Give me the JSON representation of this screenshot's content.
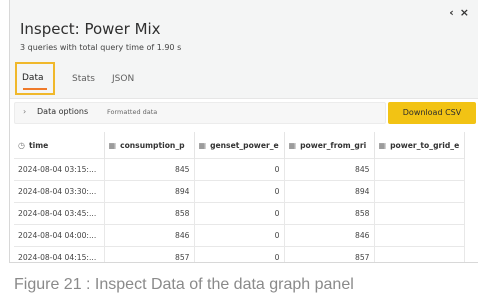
{
  "window": {
    "collapse_icon": "‹",
    "close_icon": "×"
  },
  "header": {
    "title": "Inspect: Power Mix",
    "subtitle": "3 queries with total query time of 1.90 s"
  },
  "tabs": [
    {
      "label": "Data",
      "active": true
    },
    {
      "label": "Stats",
      "active": false
    },
    {
      "label": "JSON",
      "active": false
    }
  ],
  "options": {
    "label": "Data options",
    "hint": "Formatted data",
    "download_label": "Download CSV"
  },
  "table": {
    "columns": [
      {
        "icon": "clock-icon",
        "glyph": "◷",
        "label": "time"
      },
      {
        "icon": "table-icon",
        "glyph": "▦",
        "label": "consumption_p"
      },
      {
        "icon": "table-icon",
        "glyph": "▦",
        "label": "genset_power_e"
      },
      {
        "icon": "table-icon",
        "glyph": "▦",
        "label": "power_from_gri"
      },
      {
        "icon": "table-icon",
        "glyph": "▦",
        "label": "power_to_grid_e"
      }
    ],
    "rows": [
      [
        "2024-08-04 03:15:...",
        "845",
        "0",
        "845",
        ""
      ],
      [
        "2024-08-04 03:30:...",
        "894",
        "0",
        "894",
        ""
      ],
      [
        "2024-08-04 03:45:...",
        "858",
        "0",
        "858",
        ""
      ],
      [
        "2024-08-04 04:00:...",
        "846",
        "0",
        "846",
        ""
      ],
      [
        "2024-08-04 04:15:...",
        "857",
        "0",
        "857",
        ""
      ]
    ]
  },
  "caption": "Figure 21 : Inspect Data of the data graph panel",
  "colors": {
    "accent": "#f2c314",
    "tab_underline": "#ef7a2a",
    "tab_border": "#f0b82b"
  }
}
